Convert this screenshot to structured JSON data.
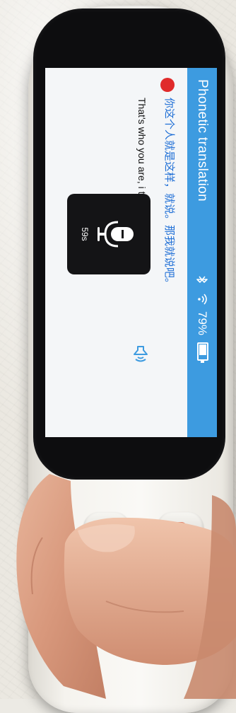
{
  "status_bar": {
    "title": "Phonetic translation",
    "battery_percent": "79%",
    "battery_level": 0.79,
    "icons": [
      "bluetooth-icon",
      "wifi-icon",
      "battery-icon"
    ]
  },
  "transcript": {
    "chinese": "你这个人就是这样，就说。那我就说吧。",
    "english": "That's who you are, i tell you."
  },
  "voice_overlay": {
    "icon": "microphone-icon",
    "timer": "59s"
  },
  "colors": {
    "status_bar": "#3d9be0",
    "chinese_text": "#1f6fd6",
    "record_dot": "#e02b2b",
    "overlay": "#141416"
  }
}
